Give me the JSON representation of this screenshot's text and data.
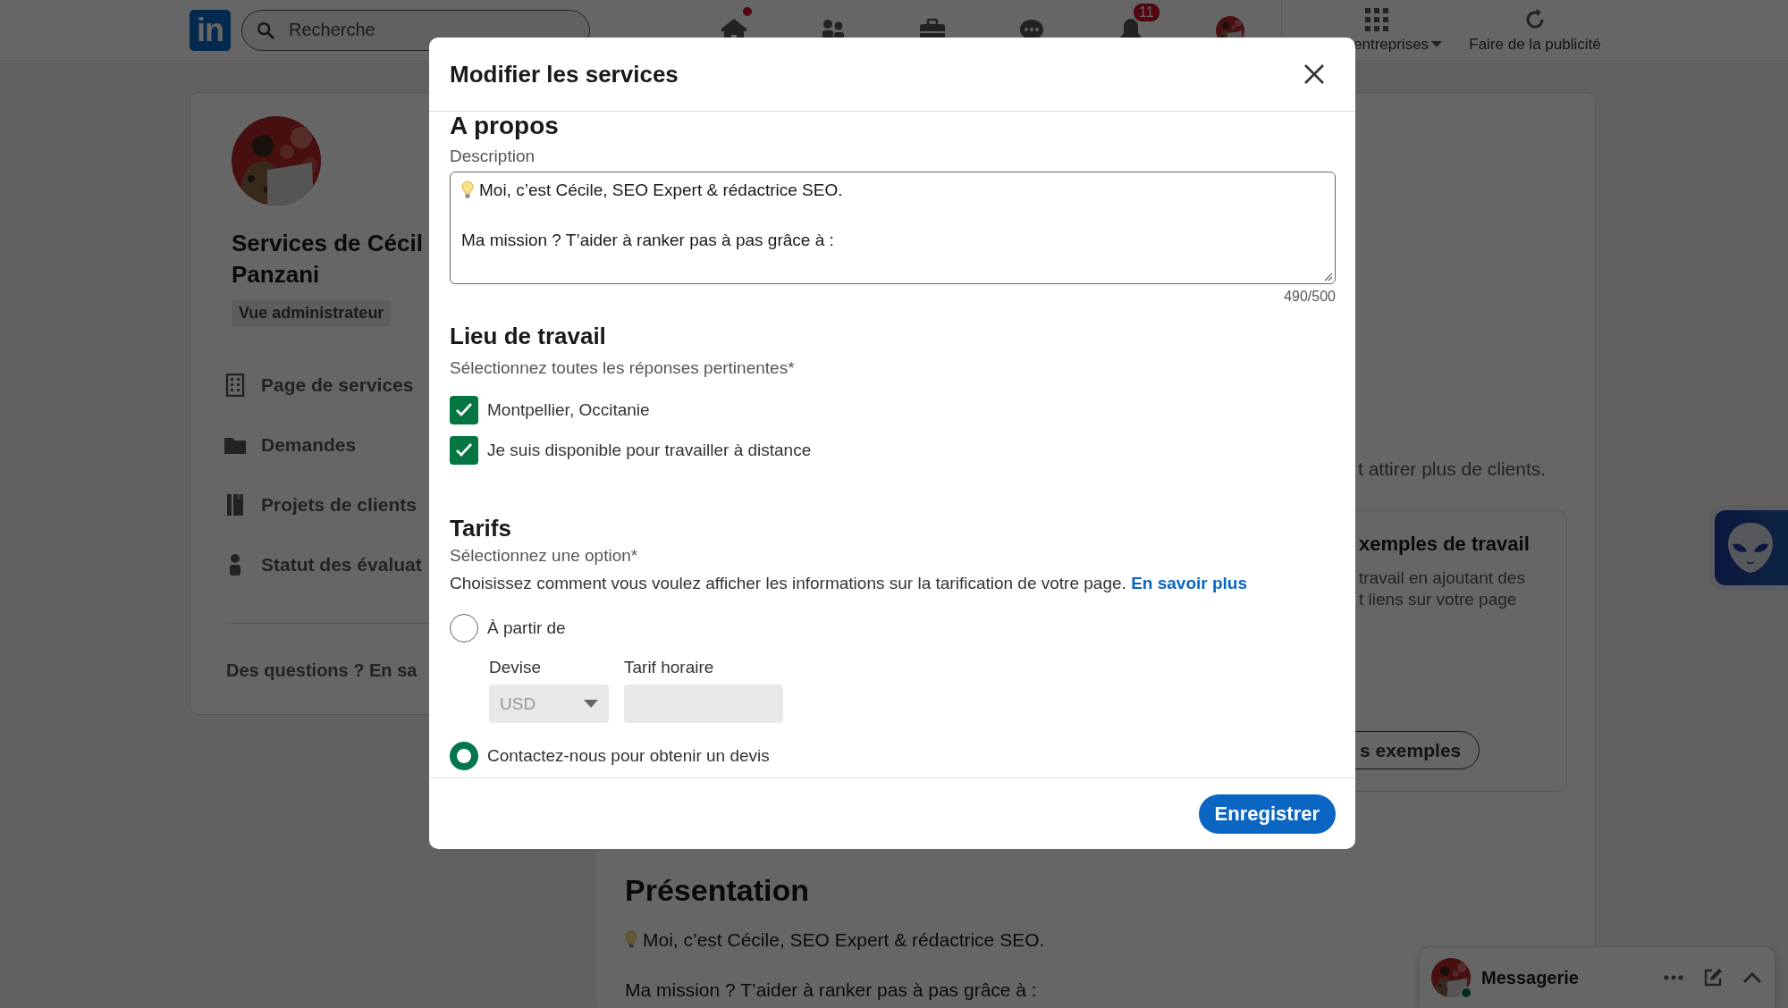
{
  "topbar": {
    "logo": "in",
    "search": {
      "placeholder": "Recherche"
    },
    "nav": [
      {
        "kind": "home",
        "dot": true
      },
      {
        "kind": "network",
        "dot": false
      },
      {
        "kind": "jobs",
        "dot": false
      },
      {
        "kind": "messaging",
        "dot": false
      },
      {
        "kind": "notifications",
        "dot": false,
        "badge": "11"
      },
      {
        "kind": "avatar",
        "dot": false
      }
    ],
    "business": {
      "label": "entreprises"
    },
    "advertise": {
      "label": "Faire de la publicité"
    }
  },
  "sidebar": {
    "title_lines": [
      "Services de Cécil",
      "Panzani"
    ],
    "role": "Vue administrateur",
    "items": [
      {
        "label": "Page de services"
      },
      {
        "label": "Demandes"
      },
      {
        "label": "Projets de clients"
      },
      {
        "label": "Statut des évaluat"
      }
    ],
    "help": "Des questions ? En sa"
  },
  "main": {
    "intro": "t attirer plus de clients.",
    "examples": {
      "title": "xemples de travail",
      "lines": [
        "travail en ajoutant des",
        "t liens sur votre page"
      ],
      "button": "s exemples"
    },
    "presentation": {
      "title": "Présentation",
      "lines": [
        "Moi, c’est Cécile, SEO Expert & rédactrice SEO.",
        "Ma mission ? T’aider à ranker pas à pas grâce à :"
      ]
    }
  },
  "modal": {
    "title": "Modifier les services",
    "about": {
      "heading": "A propos",
      "label": "Description",
      "paragraphs": [
        "Moi, c’est Cécile, SEO Expert & rédactrice SEO.",
        "Ma mission ? T’aider à ranker pas à pas grâce à :"
      ],
      "counter": "490/500"
    },
    "workplace": {
      "heading": "Lieu de travail",
      "hint": "Sélectionnez toutes les réponses pertinentes*",
      "options": [
        {
          "label": "Montpellier, Occitanie",
          "checked": true
        },
        {
          "label": "Je suis disponible pour travailler à distance",
          "checked": true
        }
      ]
    },
    "pricing": {
      "heading": "Tarifs",
      "hint": "Sélectionnez une option*",
      "description": "Choisissez comment vous voulez afficher les informations sur la tarification de votre page.",
      "link": "En savoir plus",
      "options": [
        {
          "label": "À partir de",
          "selected": false
        },
        {
          "label": "Contactez-nous pour obtenir un devis",
          "selected": true
        }
      ],
      "currency": {
        "label": "Devise",
        "value": "USD",
        "disabled": true
      },
      "rate": {
        "label": "Tarif horaire",
        "disabled": true
      }
    },
    "save_button": "Enregistrer"
  },
  "messaging": {
    "label": "Messagerie",
    "online": true
  }
}
